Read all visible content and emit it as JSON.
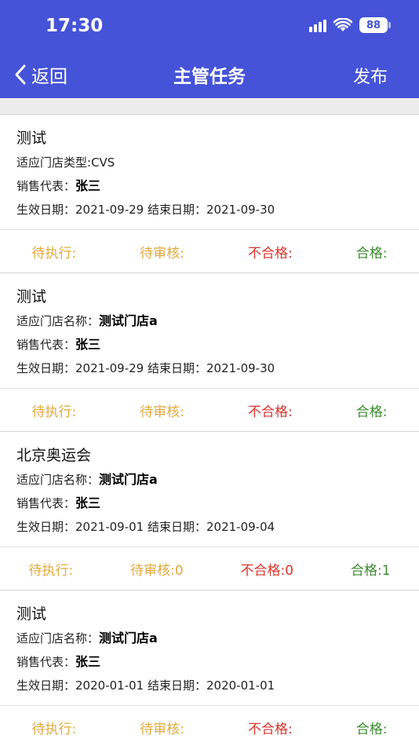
{
  "status_bar": {
    "time": "17:30",
    "battery": "88"
  },
  "nav": {
    "back_label": "返回",
    "title": "主管任务",
    "publish_label": "发布"
  },
  "colors": {
    "header": "#4553d8",
    "pending": "#e3a93b",
    "fail": "#d9342b",
    "pass": "#3a8a2e"
  },
  "tasks": [
    {
      "title": "测试",
      "scope_label": "适应门店类型:",
      "scope_value": "CVS",
      "rep_label": "销售代表：",
      "rep_value": "张三",
      "start_label": "生效日期：",
      "start_value": "2021-09-29",
      "end_label": "结束日期：",
      "end_value": "2021-09-30",
      "pending": "待执行:",
      "review": "待审核:",
      "fail": "不合格:",
      "pass": "合格:"
    },
    {
      "title": "测试",
      "scope_label": "适应门店名称：",
      "scope_value": "测试门店a",
      "rep_label": "销售代表：",
      "rep_value": "张三",
      "start_label": "生效日期：",
      "start_value": "2021-09-29",
      "end_label": "结束日期：",
      "end_value": "2021-09-30",
      "pending": "待执行:",
      "review": "待审核:",
      "fail": "不合格:",
      "pass": "合格:"
    },
    {
      "title": "北京奥运会",
      "scope_label": "适应门店名称：",
      "scope_value": "测试门店a",
      "rep_label": "销售代表：",
      "rep_value": "张三",
      "start_label": "生效日期：",
      "start_value": "2021-09-01",
      "end_label": "结束日期：",
      "end_value": "2021-09-04",
      "pending": "待执行:",
      "review": "待审核:0",
      "fail": "不合格:0",
      "pass": "合格:1"
    },
    {
      "title": "测试",
      "scope_label": "适应门店名称：",
      "scope_value": "测试门店a",
      "rep_label": "销售代表：",
      "rep_value": "张三",
      "start_label": "生效日期：",
      "start_value": "2020-01-01",
      "end_label": "结束日期：",
      "end_value": "2020-01-01",
      "pending": "待执行:",
      "review": "待审核:",
      "fail": "不合格:",
      "pass": "合格:"
    }
  ]
}
